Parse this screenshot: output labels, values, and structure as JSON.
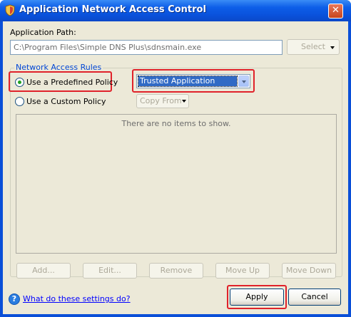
{
  "window": {
    "title": "Application Network Access Control",
    "close_label": "✕"
  },
  "app_path": {
    "label": "Application Path:",
    "value": "C:\\Program Files\\Simple DNS Plus\\sdnsmain.exe",
    "select_label": "Select"
  },
  "rules": {
    "group_title": "Network Access Rules",
    "predefined_label": "Use a Predefined Policy",
    "predefined_selected": true,
    "custom_label": "Use a Custom Policy",
    "policy_value": "Trusted Application",
    "copy_from_label": "Copy From",
    "empty_message": "There are no items to show.",
    "buttons": {
      "add": "Add...",
      "edit": "Edit...",
      "remove": "Remove",
      "move_up": "Move Up",
      "move_down": "Move Down"
    }
  },
  "footer": {
    "help_link": "What do these settings do?",
    "apply_label": "Apply",
    "cancel_label": "Cancel"
  },
  "colors": {
    "title_bar": "#0a52dc",
    "highlight": "#e0222a",
    "group_title": "#0046d5",
    "selection": "#316ac5"
  },
  "icons": {
    "app": "shield-icon",
    "close": "close-icon",
    "help": "help-icon",
    "dropdown": "chevron-down-icon"
  }
}
